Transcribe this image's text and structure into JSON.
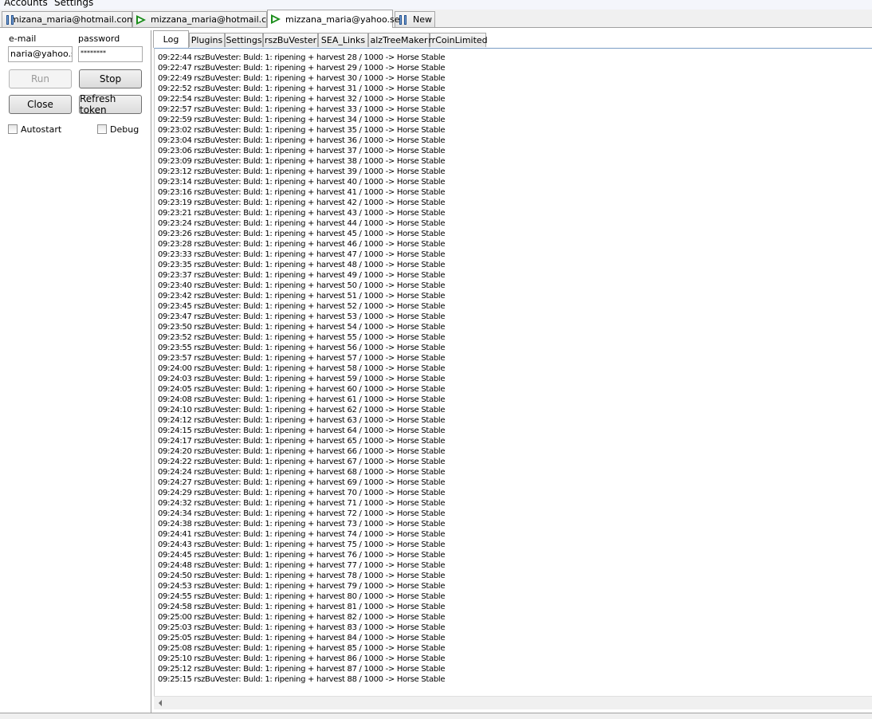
{
  "menu": {
    "accounts": "Accounts",
    "settings": "Settings"
  },
  "account_tabs": [
    {
      "label": "mizana_maria@hotmail.com",
      "icon": "pause-icon"
    },
    {
      "label": "mizzana_maria@hotmail.com",
      "icon": "play-icon"
    },
    {
      "label": "mizzana_maria@yahoo.se",
      "icon": "play-icon",
      "active": true
    },
    {
      "label": "New",
      "icon": "pause-icon"
    }
  ],
  "login": {
    "email_label": "e-mail",
    "password_label": "password",
    "email_value": "naria@yahoo.se",
    "password_value": "********"
  },
  "buttons": {
    "run": "Run",
    "stop": "Stop",
    "close": "Close",
    "refresh_token": "Refresh token"
  },
  "checkboxes": {
    "autostart": "Autostart",
    "debug": "Debug"
  },
  "inner_tabs": [
    "Log",
    "Plugins",
    "Settings",
    "rszBuVester",
    "SEA_Links",
    "alzTreeMaker",
    "rrCoinLimited"
  ],
  "log_lines": [
    "09:22:44 rszBuVester: Buld: 1: ripening + harvest 28 / 1000 -> Horse Stable",
    "09:22:47 rszBuVester: Buld: 1: ripening + harvest 29 / 1000 -> Horse Stable",
    "09:22:49 rszBuVester: Buld: 1: ripening + harvest 30 / 1000 -> Horse Stable",
    "09:22:52 rszBuVester: Buld: 1: ripening + harvest 31 / 1000 -> Horse Stable",
    "09:22:54 rszBuVester: Buld: 1: ripening + harvest 32 / 1000 -> Horse Stable",
    "09:22:57 rszBuVester: Buld: 1: ripening + harvest 33 / 1000 -> Horse Stable",
    "09:22:59 rszBuVester: Buld: 1: ripening + harvest 34 / 1000 -> Horse Stable",
    "09:23:02 rszBuVester: Buld: 1: ripening + harvest 35 / 1000 -> Horse Stable",
    "09:23:04 rszBuVester: Buld: 1: ripening + harvest 36 / 1000 -> Horse Stable",
    "09:23:06 rszBuVester: Buld: 1: ripening + harvest 37 / 1000 -> Horse Stable",
    "09:23:09 rszBuVester: Buld: 1: ripening + harvest 38 / 1000 -> Horse Stable",
    "09:23:12 rszBuVester: Buld: 1: ripening + harvest 39 / 1000 -> Horse Stable",
    "09:23:14 rszBuVester: Buld: 1: ripening + harvest 40 / 1000 -> Horse Stable",
    "09:23:16 rszBuVester: Buld: 1: ripening + harvest 41 / 1000 -> Horse Stable",
    "09:23:19 rszBuVester: Buld: 1: ripening + harvest 42 / 1000 -> Horse Stable",
    "09:23:21 rszBuVester: Buld: 1: ripening + harvest 43 / 1000 -> Horse Stable",
    "09:23:24 rszBuVester: Buld: 1: ripening + harvest 44 / 1000 -> Horse Stable",
    "09:23:26 rszBuVester: Buld: 1: ripening + harvest 45 / 1000 -> Horse Stable",
    "09:23:28 rszBuVester: Buld: 1: ripening + harvest 46 / 1000 -> Horse Stable",
    "09:23:33 rszBuVester: Buld: 1: ripening + harvest 47 / 1000 -> Horse Stable",
    "09:23:35 rszBuVester: Buld: 1: ripening + harvest 48 / 1000 -> Horse Stable",
    "09:23:37 rszBuVester: Buld: 1: ripening + harvest 49 / 1000 -> Horse Stable",
    "09:23:40 rszBuVester: Buld: 1: ripening + harvest 50 / 1000 -> Horse Stable",
    "09:23:42 rszBuVester: Buld: 1: ripening + harvest 51 / 1000 -> Horse Stable",
    "09:23:45 rszBuVester: Buld: 1: ripening + harvest 52 / 1000 -> Horse Stable",
    "09:23:47 rszBuVester: Buld: 1: ripening + harvest 53 / 1000 -> Horse Stable",
    "09:23:50 rszBuVester: Buld: 1: ripening + harvest 54 / 1000 -> Horse Stable",
    "09:23:52 rszBuVester: Buld: 1: ripening + harvest 55 / 1000 -> Horse Stable",
    "09:23:55 rszBuVester: Buld: 1: ripening + harvest 56 / 1000 -> Horse Stable",
    "09:23:57 rszBuVester: Buld: 1: ripening + harvest 57 / 1000 -> Horse Stable",
    "09:24:00 rszBuVester: Buld: 1: ripening + harvest 58 / 1000 -> Horse Stable",
    "09:24:03 rszBuVester: Buld: 1: ripening + harvest 59 / 1000 -> Horse Stable",
    "09:24:05 rszBuVester: Buld: 1: ripening + harvest 60 / 1000 -> Horse Stable",
    "09:24:08 rszBuVester: Buld: 1: ripening + harvest 61 / 1000 -> Horse Stable",
    "09:24:10 rszBuVester: Buld: 1: ripening + harvest 62 / 1000 -> Horse Stable",
    "09:24:12 rszBuVester: Buld: 1: ripening + harvest 63 / 1000 -> Horse Stable",
    "09:24:15 rszBuVester: Buld: 1: ripening + harvest 64 / 1000 -> Horse Stable",
    "09:24:17 rszBuVester: Buld: 1: ripening + harvest 65 / 1000 -> Horse Stable",
    "09:24:20 rszBuVester: Buld: 1: ripening + harvest 66 / 1000 -> Horse Stable",
    "09:24:22 rszBuVester: Buld: 1: ripening + harvest 67 / 1000 -> Horse Stable",
    "09:24:24 rszBuVester: Buld: 1: ripening + harvest 68 / 1000 -> Horse Stable",
    "09:24:27 rszBuVester: Buld: 1: ripening + harvest 69 / 1000 -> Horse Stable",
    "09:24:29 rszBuVester: Buld: 1: ripening + harvest 70 / 1000 -> Horse Stable",
    "09:24:32 rszBuVester: Buld: 1: ripening + harvest 71 / 1000 -> Horse Stable",
    "09:24:34 rszBuVester: Buld: 1: ripening + harvest 72 / 1000 -> Horse Stable",
    "09:24:38 rszBuVester: Buld: 1: ripening + harvest 73 / 1000 -> Horse Stable",
    "09:24:41 rszBuVester: Buld: 1: ripening + harvest 74 / 1000 -> Horse Stable",
    "09:24:43 rszBuVester: Buld: 1: ripening + harvest 75 / 1000 -> Horse Stable",
    "09:24:45 rszBuVester: Buld: 1: ripening + harvest 76 / 1000 -> Horse Stable",
    "09:24:48 rszBuVester: Buld: 1: ripening + harvest 77 / 1000 -> Horse Stable",
    "09:24:50 rszBuVester: Buld: 1: ripening + harvest 78 / 1000 -> Horse Stable",
    "09:24:53 rszBuVester: Buld: 1: ripening + harvest 79 / 1000 -> Horse Stable",
    "09:24:55 rszBuVester: Buld: 1: ripening + harvest 80 / 1000 -> Horse Stable",
    "09:24:58 rszBuVester: Buld: 1: ripening + harvest 81 / 1000 -> Horse Stable",
    "09:25:00 rszBuVester: Buld: 1: ripening + harvest 82 / 1000 -> Horse Stable",
    "09:25:03 rszBuVester: Buld: 1: ripening + harvest 83 / 1000 -> Horse Stable",
    "09:25:05 rszBuVester: Buld: 1: ripening + harvest 84 / 1000 -> Horse Stable",
    "09:25:08 rszBuVester: Buld: 1: ripening + harvest 85 / 1000 -> Horse Stable",
    "09:25:10 rszBuVester: Buld: 1: ripening + harvest 86 / 1000 -> Horse Stable",
    "09:25:12 rszBuVester: Buld: 1: ripening + harvest 87 / 1000 -> Horse Stable",
    "09:25:15 rszBuVester: Buld: 1: ripening + harvest 88 / 1000 -> Horse Stable"
  ]
}
